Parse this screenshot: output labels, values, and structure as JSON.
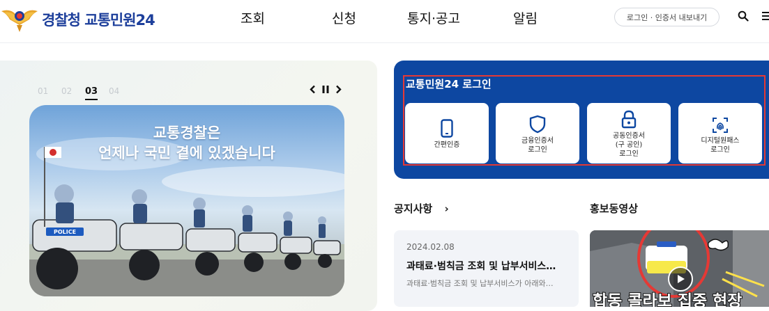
{
  "header": {
    "logo_text": "경찰청 교통민원24",
    "nav": [
      "조회",
      "신청",
      "통지·공고",
      "알림"
    ],
    "login_pill": "로그인 · 인증서 내보내기",
    "icons": [
      "search-icon",
      "menu-icon"
    ]
  },
  "hero": {
    "slides": [
      "01",
      "02",
      "03",
      "04"
    ],
    "active_slide": "03",
    "caption_line1": "교통경찰은",
    "caption_line2": "언제나 국민 곁에 있겠습니다",
    "badge_text": "POLICE"
  },
  "login": {
    "title": "교통민원24 로그인",
    "buttons": [
      {
        "label": "간편인증",
        "icon": "phone-icon"
      },
      {
        "label": "금융인증서\n로그인",
        "icon": "shield-icon"
      },
      {
        "label": "공동인증서\n(구 공인)\n로그인",
        "icon": "lock-icon"
      },
      {
        "label": "디지털원패스\n로그인",
        "icon": "fingerprint-icon"
      }
    ]
  },
  "notice": {
    "title": "공지사항",
    "arrow": "›",
    "date": "2024.02.08",
    "item_title": "과태료·범칙금 조회 및 납부서비스…",
    "item_desc": "과태료·범칙금 조회 및 납부서비스가 아래와…"
  },
  "promo": {
    "title": "홍보동영상",
    "video_caption": "합동 콜라보 집중 현장"
  },
  "colors": {
    "brand_blue": "#0d47a1",
    "logo_blue": "#1d3f9b",
    "highlight_red": "#e53935"
  }
}
